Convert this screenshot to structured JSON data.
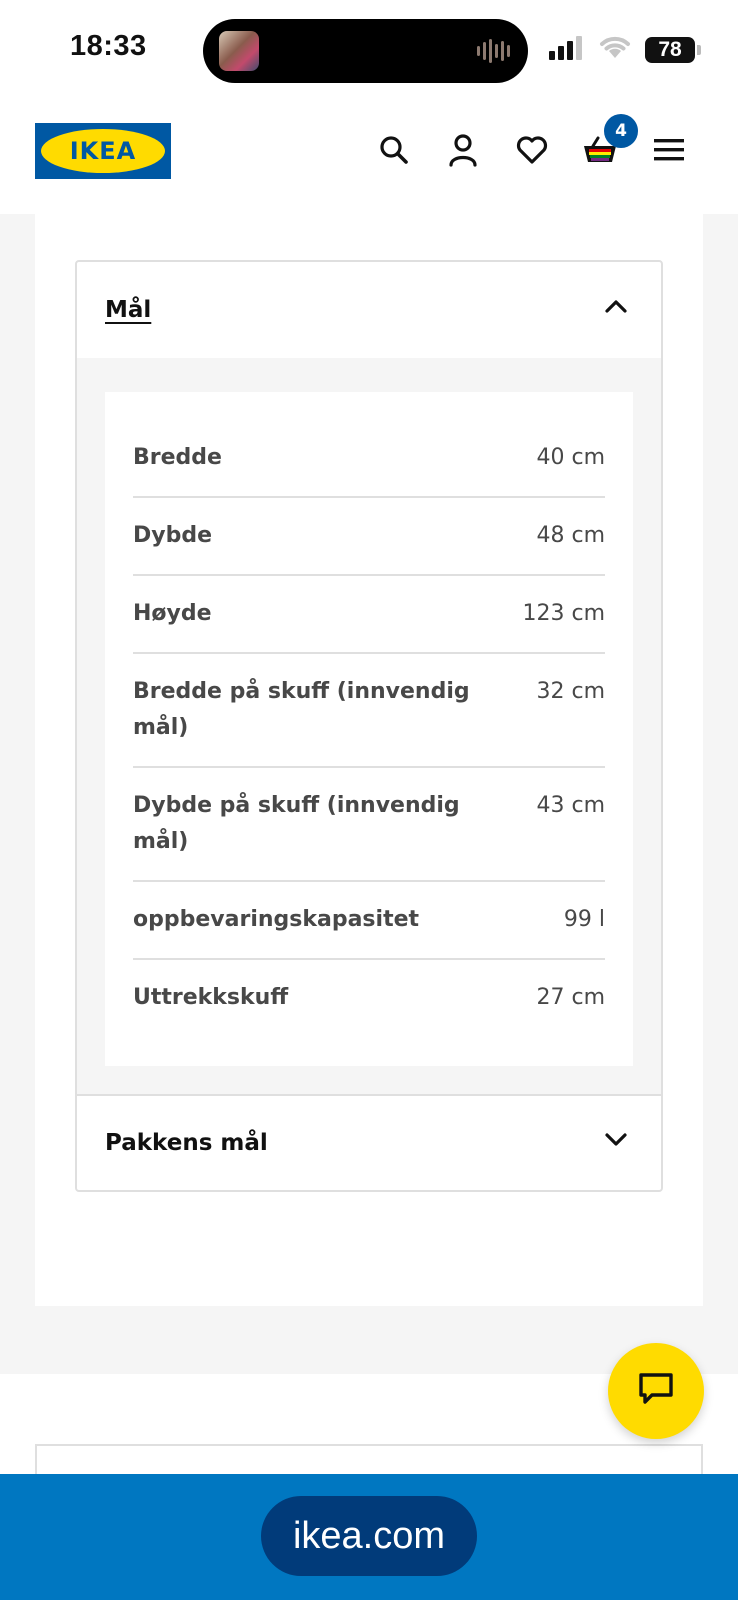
{
  "status_bar": {
    "time": "18:33",
    "battery": "78",
    "icons": [
      "cellular-signal-icon",
      "wifi-icon",
      "battery-icon",
      "now-playing-thumbnail",
      "audio-waveform-icon"
    ]
  },
  "header": {
    "logo_text": "IKEA",
    "cart_count": "4",
    "icons": [
      "search-icon",
      "account-icon",
      "heart-icon",
      "cart-icon",
      "menu-icon"
    ],
    "colors": {
      "brand_blue": "#0058a3",
      "brand_yellow": "#ffdb00"
    }
  },
  "dimensions": {
    "section_title": "Mål",
    "rows": [
      {
        "label": "Bredde",
        "value": "40 cm"
      },
      {
        "label": "Dybde",
        "value": "48 cm"
      },
      {
        "label": "Høyde",
        "value": "123 cm"
      },
      {
        "label": "Bredde på skuff (innvendig mål)",
        "value": "32 cm"
      },
      {
        "label": "Dybde på skuff (innvendig mål)",
        "value": "43 cm"
      },
      {
        "label": "oppbevaringskapasitet",
        "value": "99 l"
      },
      {
        "label": "Uttrekkskuff",
        "value": "27 cm"
      }
    ]
  },
  "package": {
    "section_title": "Pakkens mål"
  },
  "chat": {
    "icon": "chat-icon"
  },
  "browser": {
    "url": "ikea.com"
  }
}
